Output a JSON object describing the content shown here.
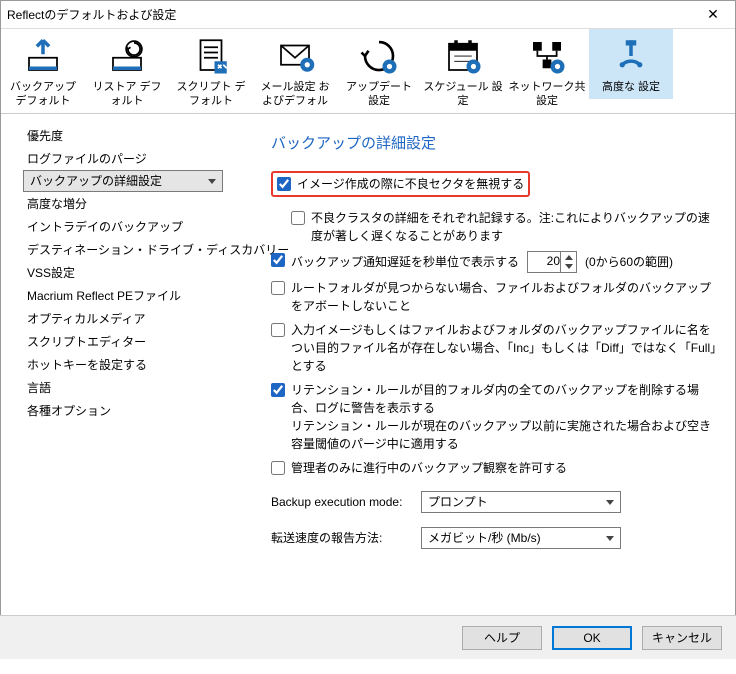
{
  "title": "Reflectのデフォルトおよび設定",
  "toolbar": [
    {
      "label": "バックアップ デフォルト"
    },
    {
      "label": "リストア デフォルト"
    },
    {
      "label": "スクリプト デフォルト"
    },
    {
      "label": "メール設定 およびデフォル"
    },
    {
      "label": "アップデート 設定"
    },
    {
      "label": "スケジュール 設定"
    },
    {
      "label": "ネットワーク共 設定"
    },
    {
      "label": "高度な 設定"
    }
  ],
  "sidebar": [
    "優先度",
    "ログファイルのパージ",
    "バックアップの詳細設定",
    "高度な増分",
    "イントラデイのバックアップ",
    "デスティネーション・ドライブ・ディスカバリー",
    "VSS設定",
    "Macrium Reflect PEファイル",
    "オプティカルメディア",
    "スクリプトエディター",
    "ホットキーを設定する",
    "言語",
    "各種オプション"
  ],
  "heading": "バックアップの詳細設定",
  "opts": {
    "o1": "イメージ作成の際に不良セクタを無視する",
    "o2": "不良クラスタの詳細をそれぞれ記録する。注:これによりバックアップの速度が著しく遅くなることがあります",
    "o3a": "バックアップ通知遅延を秒単位で表示する",
    "o3num": "20",
    "o3b": "(0から60の範囲)",
    "o4": "ルートフォルダが見つからない場合、ファイルおよびフォルダのバックアップをアボートしないこと",
    "o5": "入力イメージもしくはファイルおよびフォルダのバックアップファイルに名をつい目的ファイル名が存在しない場合、「Inc」もしくは「Diff」ではなく「Full」とする",
    "o6a": "リテンション・ルールが目的フォルダ内の全てのバックアップを削除する場合、ログに警告を表示する",
    "o6b": "リテンション・ルールが現在のバックアップ以前に実施された場合および空き容量閾値のパージ中に適用する",
    "o7": "管理者のみに進行中のバックアップ観察を許可する",
    "bem_label": "Backup execution mode:",
    "bem_value": "プロンプト",
    "rate_label": "転送速度の報告方法:",
    "rate_value": "メガビット/秒 (Mb/s)"
  },
  "footer": {
    "help": "ヘルプ",
    "ok": "OK",
    "cancel": "キャンセル"
  }
}
